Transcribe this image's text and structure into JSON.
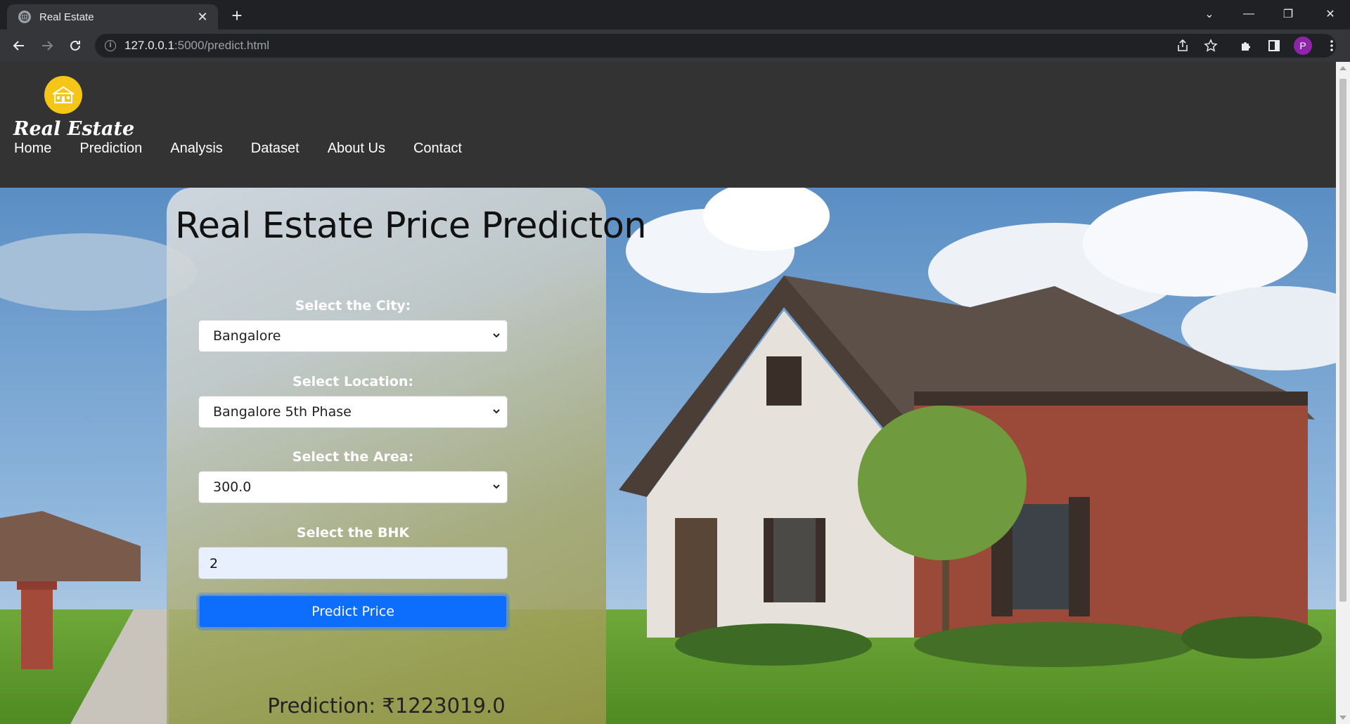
{
  "browser": {
    "tab_title": "Real Estate",
    "url_host": "127.0.0.1",
    "url_path": ":5000/predict.html",
    "avatar_letter": "P"
  },
  "site": {
    "brand": "Real Estate",
    "nav": [
      "Home",
      "Prediction",
      "Analysis",
      "Dataset",
      "About Us",
      "Contact"
    ]
  },
  "form": {
    "title": "Real Estate Price Predicton",
    "city_label": "Select the City:",
    "city_value": "Bangalore",
    "location_label": "Select Location:",
    "location_value": "Bangalore 5th Phase",
    "area_label": "Select the Area:",
    "area_value": "300.0",
    "bhk_label": "Select the BHK",
    "bhk_value": "2",
    "button_label": "Predict Price",
    "prediction": "Prediction: ₹1223019.0"
  },
  "colors": {
    "header_bg": "#333333",
    "logo_bg": "#f5c518",
    "button_bg": "#0d6efd"
  }
}
